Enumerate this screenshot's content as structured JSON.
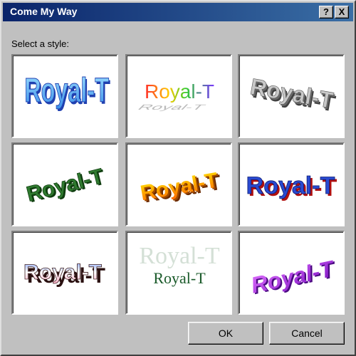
{
  "window": {
    "title": "Come My Way"
  },
  "titlebar": {
    "help_glyph": "?",
    "close_glyph": "X"
  },
  "prompt": "Select a style:",
  "styles": [
    {
      "label": "Royal-T",
      "icon": "wordart-style-blue-arch",
      "colors": [
        "#6ec1ff",
        "#2a5fd1"
      ]
    },
    {
      "label": "Royal-T",
      "icon": "wordart-style-rainbow-shadow",
      "colors": [
        "#ff2a2a",
        "#ffcc00",
        "#33cc33",
        "#7a33ff"
      ]
    },
    {
      "label": "Royal-T",
      "icon": "wordart-style-gray-3d-slant",
      "colors": [
        "#b0b0b0",
        "#505050"
      ]
    },
    {
      "label": "Royal-T",
      "icon": "wordart-style-green-textured",
      "colors": [
        "#2a6b2a",
        "#0f3d0f"
      ]
    },
    {
      "label": "Royal-T",
      "icon": "wordart-style-orange-3d",
      "colors": [
        "#ffcc00",
        "#ff7a00",
        "#8a3d00"
      ]
    },
    {
      "label": "Royal-T",
      "icon": "wordart-style-blue-red-shadow",
      "colors": [
        "#2a4ad1",
        "#b01010"
      ]
    },
    {
      "label": "Royal-T",
      "icon": "wordart-style-pink-blue-shadow",
      "colors": [
        "#ffd0e0",
        "#3a1a1a",
        "#8aa8ff"
      ]
    },
    {
      "label": "Royal-T",
      "ghost_label": "Royal-T",
      "icon": "wordart-style-serif-ghost",
      "colors": [
        "#1a5a2a",
        "#c8d8cc"
      ]
    },
    {
      "label": "Royal-T",
      "icon": "wordart-style-purple-tilt",
      "colors": [
        "#c040ff",
        "#5a10a0"
      ]
    }
  ],
  "buttons": {
    "ok": "OK",
    "cancel": "Cancel"
  }
}
